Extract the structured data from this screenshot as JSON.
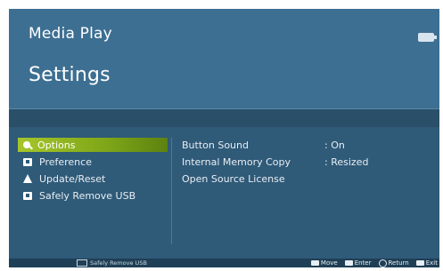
{
  "header": {
    "app_title": "Media Play",
    "page_title": "Settings",
    "usb_icon": "usb-device-icon"
  },
  "menu": {
    "items": [
      {
        "label": "Options",
        "icon": "options-icon",
        "selected": true
      },
      {
        "label": "Preference",
        "icon": "preference-icon",
        "selected": false
      },
      {
        "label": "Update/Reset",
        "icon": "update-icon",
        "selected": false
      },
      {
        "label": "Safely Remove USB",
        "icon": "usb-remove-icon",
        "selected": false
      }
    ]
  },
  "settings": {
    "rows": [
      {
        "label": "Button Sound",
        "value": ": On"
      },
      {
        "label": "Internal Memory Copy",
        "value": ": Resized"
      },
      {
        "label": "Open Source License",
        "value": ""
      }
    ]
  },
  "footer": {
    "left_hint": "Safely Remove USB",
    "hints": [
      {
        "label": "Move",
        "icon": "dpad-icon"
      },
      {
        "label": "Enter",
        "icon": "enter-icon"
      },
      {
        "label": "Return",
        "icon": "return-icon"
      },
      {
        "label": "Exit",
        "icon": "exit-icon"
      }
    ]
  },
  "colors": {
    "header_bg": "#3d6f92",
    "content_bg": "#2f5a78",
    "selected_accent": "#8fb321"
  }
}
